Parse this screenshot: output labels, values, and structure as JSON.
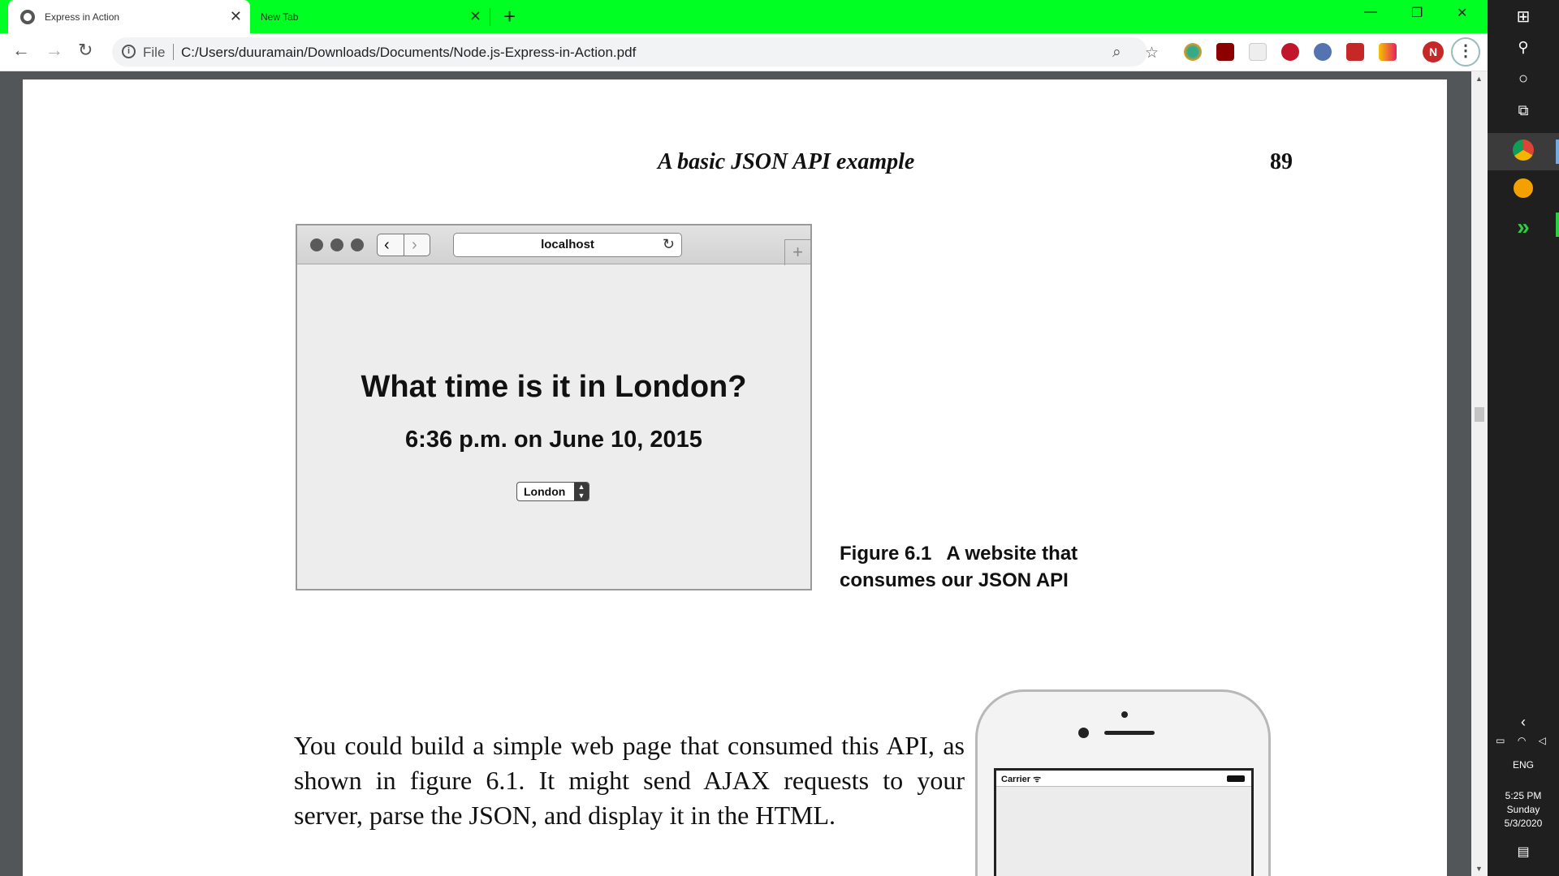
{
  "browser": {
    "tabs": [
      {
        "title": "Express in Action",
        "active": true
      },
      {
        "title": "New Tab",
        "active": false
      }
    ],
    "close_glyph": "✕",
    "new_tab_glyph": "+",
    "window_controls": {
      "minimize": "—",
      "restore": "❐",
      "close": "✕"
    },
    "scheme_label": "File",
    "url": "C:/Users/duuramain/Downloads/Documents/Node.js-Express-in-Action.pdf",
    "profile_initial": "N",
    "accent_color": "#00ff22"
  },
  "pdf": {
    "running_head": "A basic JSON API example",
    "page_number": "89",
    "figure": {
      "address": "localhost",
      "heading": "What time is it in London?",
      "time": "6:36 p.m. on June 10, 2015",
      "select_value": "London",
      "caption_label": "Figure 6.1",
      "caption_text": "A website that consumes our JSON API"
    },
    "body_paragraph": "You could build a simple web page that consumed this API, as shown in figure 6.1. It might send AJAX requests to your server, parse the JSON, and display it in the HTML.",
    "phone": {
      "carrier": "Carrier"
    }
  },
  "taskbar": {
    "language": "ENG",
    "time": "5:25 PM",
    "day": "Sunday",
    "date": "5/3/2020"
  }
}
